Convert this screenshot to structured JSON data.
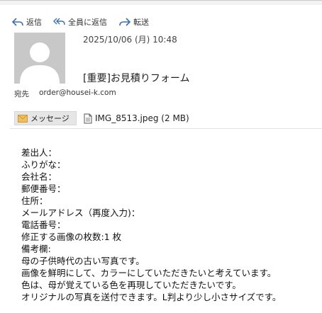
{
  "toolbar": {
    "reply": "返信",
    "reply_all": "全員に返信",
    "forward": "転送"
  },
  "message": {
    "date": "2025/10/06 (月) 10:48",
    "subject": "[重要]お見積りフォーム",
    "to_label": "宛先",
    "to_value": "order@housei-k.com"
  },
  "attachments": {
    "message_tab": "メッセージ",
    "file": "IMG_8513.jpeg (2 MB)"
  },
  "body": {
    "lines": [
      "差出人：",
      "ふりがな：",
      "会社名：",
      "郵便番号：",
      "住所：",
      "メールアドレス（再度入力)：",
      "電話番号：",
      "修正する画像の枚数:1 枚",
      "備考欄:",
      "母の子供時代の古い写真です。",
      "画像を鮮明にして、カラーにしていただきたいと考えています。",
      "色は、母が覚えている色を再現していただきたいです。",
      "オリジナルの写真を送付できます。L判より少し小さサイズです。"
    ]
  },
  "colors": {
    "accent_icon": "#3d6fb6",
    "avatar_bg": "#c8c8c8",
    "message_tab_bg": "#e6e6e6"
  }
}
